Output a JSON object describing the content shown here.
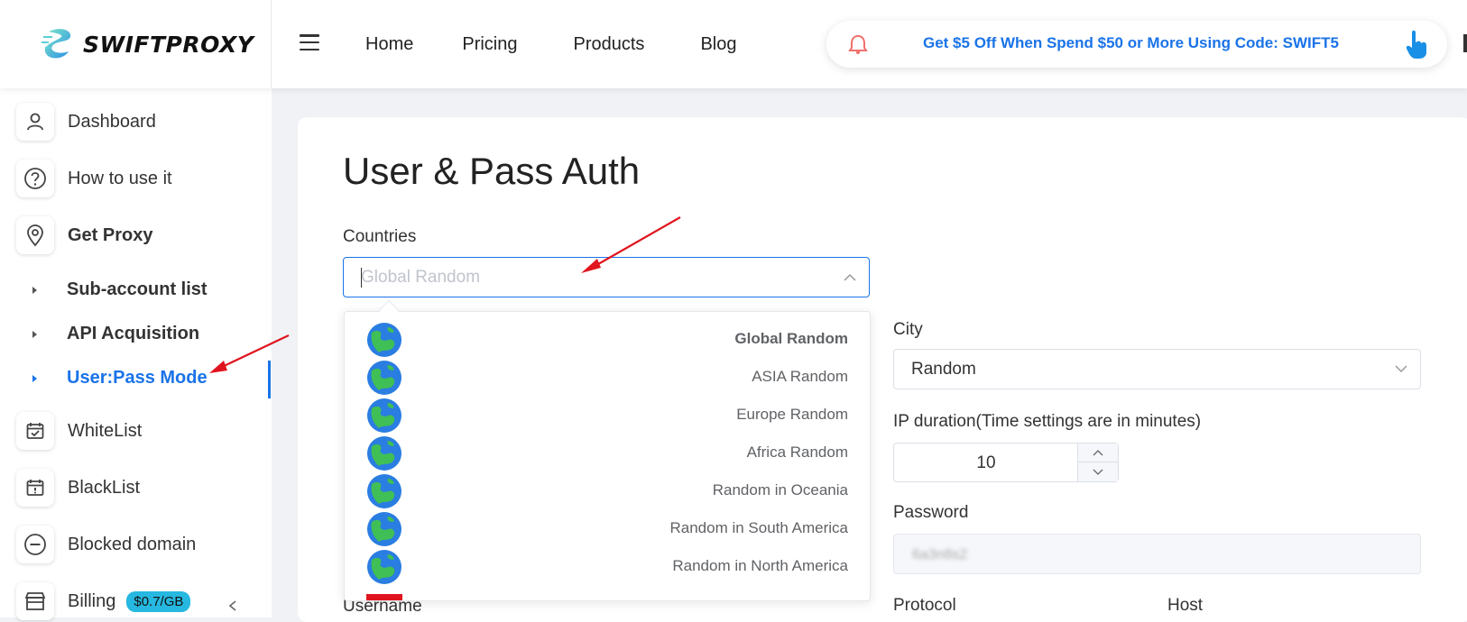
{
  "brand": {
    "logo_text": "SWIFTPROXY"
  },
  "nav": {
    "items": [
      "Home",
      "Pricing",
      "Products",
      "Blog"
    ]
  },
  "promo": {
    "text": "Get $5 Off When Spend $50 or More Using Code: SWIFT5"
  },
  "sidebar": {
    "items": [
      {
        "label": "Dashboard",
        "icon": "user-icon"
      },
      {
        "label": "How to use it",
        "icon": "help-circle-icon"
      },
      {
        "label": "Get Proxy",
        "icon": "location-pin-icon"
      },
      {
        "label": "WhiteList",
        "icon": "calendar-check-icon"
      },
      {
        "label": "BlackList",
        "icon": "calendar-alert-icon"
      },
      {
        "label": "Blocked domain",
        "icon": "minus-circle-icon"
      },
      {
        "label": "Billing",
        "icon": "store-icon",
        "badge": "$0.7/GB"
      }
    ],
    "sub_items": [
      {
        "label": "Sub-account list",
        "active": false
      },
      {
        "label": "API Acquisition",
        "active": false
      },
      {
        "label": "User:Pass Mode",
        "active": true
      }
    ]
  },
  "main": {
    "title": "User & Pass Auth",
    "countries": {
      "label": "Countries",
      "placeholder": "Global Random"
    },
    "city": {
      "label": "City",
      "value": "Random"
    },
    "ip_duration": {
      "label": "IP duration(Time settings are in minutes)",
      "value": "10"
    },
    "password": {
      "label": "Password",
      "value": "6a3n8s2"
    },
    "protocol": {
      "label": "Protocol"
    },
    "host": {
      "label": "Host"
    },
    "username": {
      "label": "Username"
    }
  },
  "dropdown": {
    "options": [
      {
        "label": "Global Random",
        "selected": true
      },
      {
        "label": "ASIA Random",
        "selected": false
      },
      {
        "label": "Europe Random",
        "selected": false
      },
      {
        "label": "Africa Random",
        "selected": false
      },
      {
        "label": "Random in Oceania",
        "selected": false
      },
      {
        "label": "Random in South America",
        "selected": false
      },
      {
        "label": "Random in North America",
        "selected": false
      }
    ]
  },
  "colors": {
    "accent": "#1a73e8",
    "annotation_arrow": "#e0141e",
    "badge": "#26b8e0"
  }
}
